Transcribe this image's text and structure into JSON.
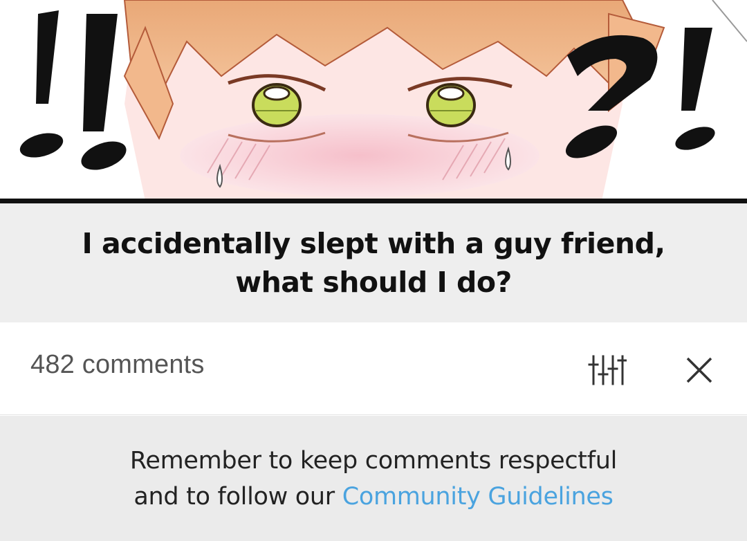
{
  "post": {
    "title_line1": "I accidentally slept with a guy friend,",
    "title_line2": "what should I do?"
  },
  "comments_header": {
    "count_label": "482 comments",
    "filter_icon": "sliders-icon",
    "close_icon": "close-icon"
  },
  "notice": {
    "line1": "Remember to keep comments respectful",
    "line2_prefix": "and to follow our ",
    "link_label": "Community Guidelines"
  },
  "colors": {
    "link": "#4aa3df",
    "title_bg": "#eeeeee",
    "notice_bg": "#ebebeb"
  }
}
